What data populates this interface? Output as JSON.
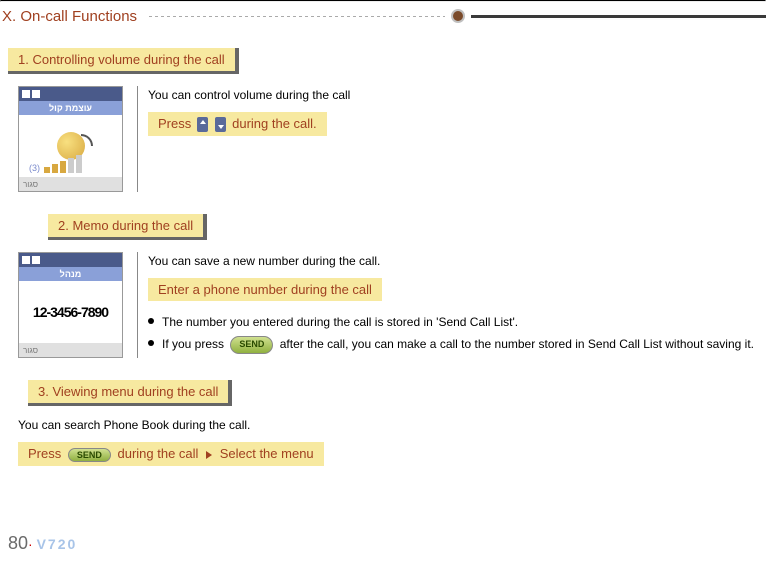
{
  "chapter": {
    "title": "X. On-call Functions"
  },
  "section1": {
    "heading": "1. Controlling volume during the call",
    "intro": "You can control volume during the call",
    "instruction_pre": "Press",
    "instruction_post": "during the call.",
    "phone": {
      "title_bar": "עוצמת קול",
      "level_label": "(3)",
      "sk_left": "סגור"
    }
  },
  "section2": {
    "heading": "2. Memo during the call",
    "intro": "You can save a new number during the call.",
    "instruction": "Enter a phone number during the call",
    "phone": {
      "title_bar": "מנהל",
      "number": "12-3456-7890",
      "sk_left": "סגור"
    },
    "bullets": [
      "The number you entered during the call is stored in 'Send Call List'.",
      {
        "pre": "If you press",
        "send_label": "SEND",
        "post": "after the call, you can make a call to the number stored in Send Call List without saving it."
      }
    ]
  },
  "section3": {
    "heading": "3. Viewing menu during the call",
    "intro": "You can search Phone Book during the call.",
    "instruction_pre": "Press",
    "send_label": "SEND",
    "instruction_mid": "during the call",
    "instruction_post": "Select the menu"
  },
  "footer": {
    "page": "80",
    "model": "V720"
  }
}
